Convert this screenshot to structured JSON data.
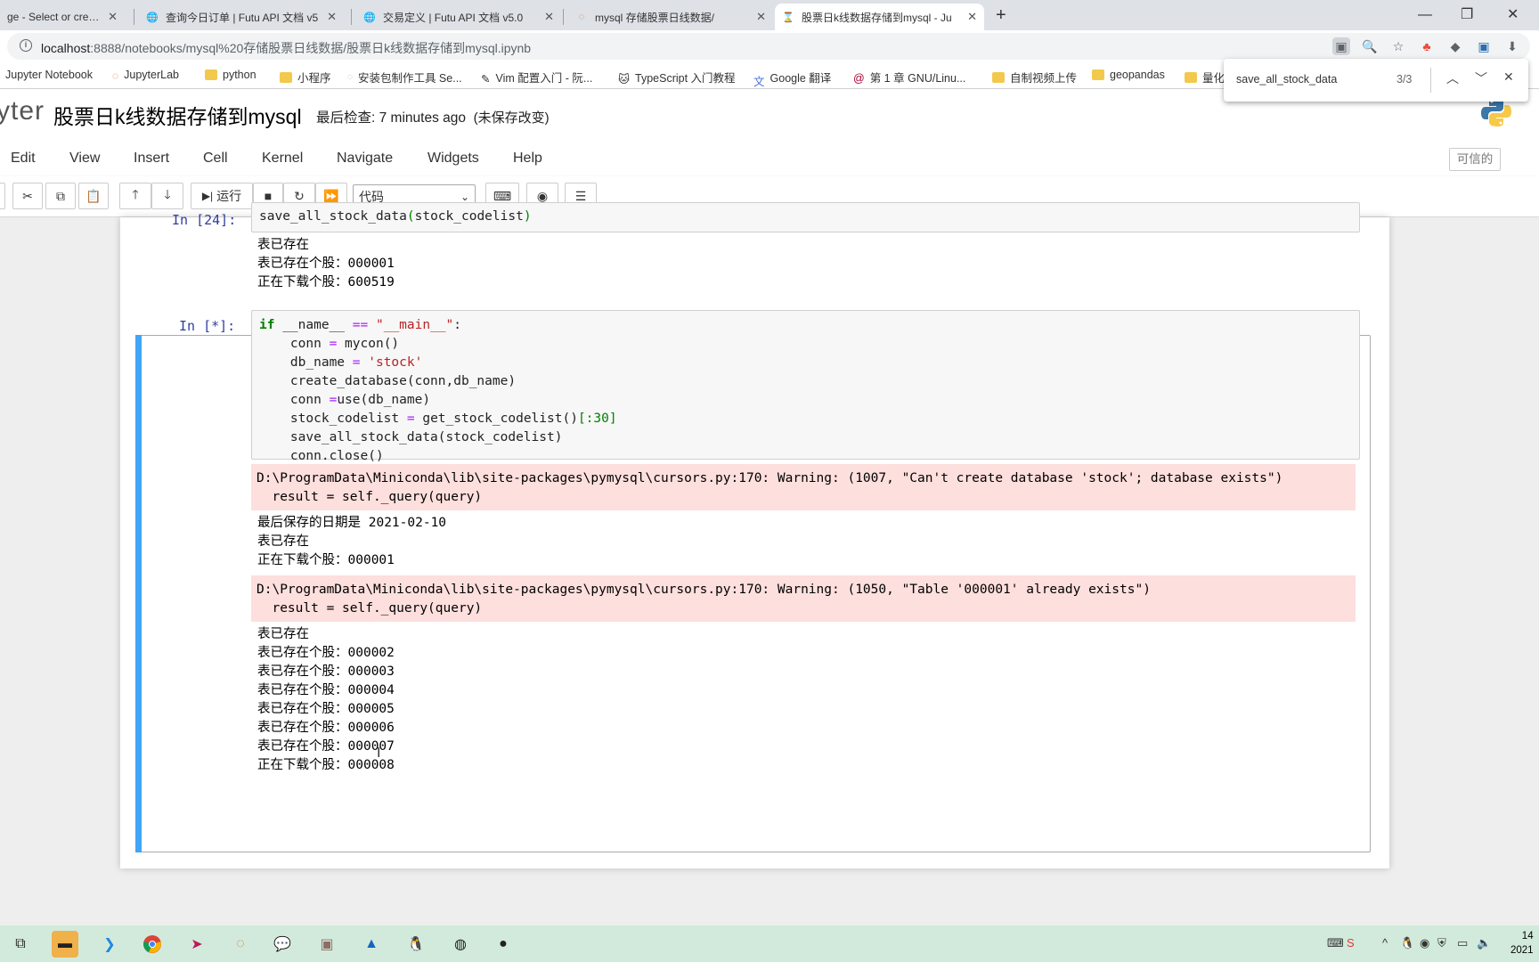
{
  "browser": {
    "tabs": [
      {
        "title": "ge - Select or create"
      },
      {
        "title": "查询今日订单 | Futu API 文档 v5"
      },
      {
        "title": "交易定义 | Futu API 文档 v5.0"
      },
      {
        "title": "mysql 存储股票日线数据/"
      },
      {
        "title": "股票日k线数据存储到mysql - Ju"
      }
    ],
    "url_host": "localhost",
    "url_rest": ":8888/notebooks/mysql%20存储股票日线数据/股票日k线数据存储到mysql.ipynb",
    "bookmarks": [
      "Jupyter Notebook",
      "JupyterLab",
      "python",
      "小程序",
      "安装包制作工具 Se...",
      "Vim 配置入门 - 阮...",
      "TypeScript 入门教程",
      "Google 翻译",
      "第 1 章 GNU/Linu...",
      "自制视频上传",
      "geopandas",
      "量化"
    ],
    "find": {
      "query": "save_all_stock_data",
      "count": "3/3"
    }
  },
  "jupyter": {
    "logo_text": "yter",
    "notebook_name": "股票日k线数据存储到mysql",
    "checkpoint": "最后检查: 7 minutes ago",
    "unsaved": "(未保存改变)",
    "menu": [
      "Edit",
      "View",
      "Insert",
      "Cell",
      "Kernel",
      "Navigate",
      "Widgets",
      "Help"
    ],
    "trusted": "可信的",
    "run_label": "运行",
    "cell_type": "代码"
  },
  "cells": {
    "cell1": {
      "prompt": "In  [24]:",
      "code_fn": "save_all_stock_data",
      "code_arg": "stock_codelist",
      "output": "表已存在\n表已存在个股：000001\n正在下载个股：600519"
    },
    "cell2": {
      "prompt": "In  [*]:",
      "stderr1": "D:\\ProgramData\\Miniconda\\lib\\site-packages\\pymysql\\cursors.py:170: Warning: (1007, \"Can't create database 'stock'; database exists\")\n  result = self._query(query)",
      "stdout1": "最后保存的日期是 2021-02-10\n表已存在\n正在下载个股：000001",
      "stderr2": "D:\\ProgramData\\Miniconda\\lib\\site-packages\\pymysql\\cursors.py:170: Warning: (1050, \"Table '000001' already exists\")\n  result = self._query(query)",
      "stdout2": "表已存在\n表已存在个股：000002\n表已存在个股：000003\n表已存在个股：000004\n表已存在个股：000005\n表已存在个股：000006\n表已存在个股：000007\n正在下载个股：000008"
    }
  },
  "taskbar": {
    "clock_line1": "14",
    "clock_line2": "2021"
  },
  "colors": {
    "selected_cell_bar": "#42a5f5",
    "stderr_bg": "#fddfdd",
    "prompt": "#303f9f",
    "taskbar": "#d2eadb"
  }
}
